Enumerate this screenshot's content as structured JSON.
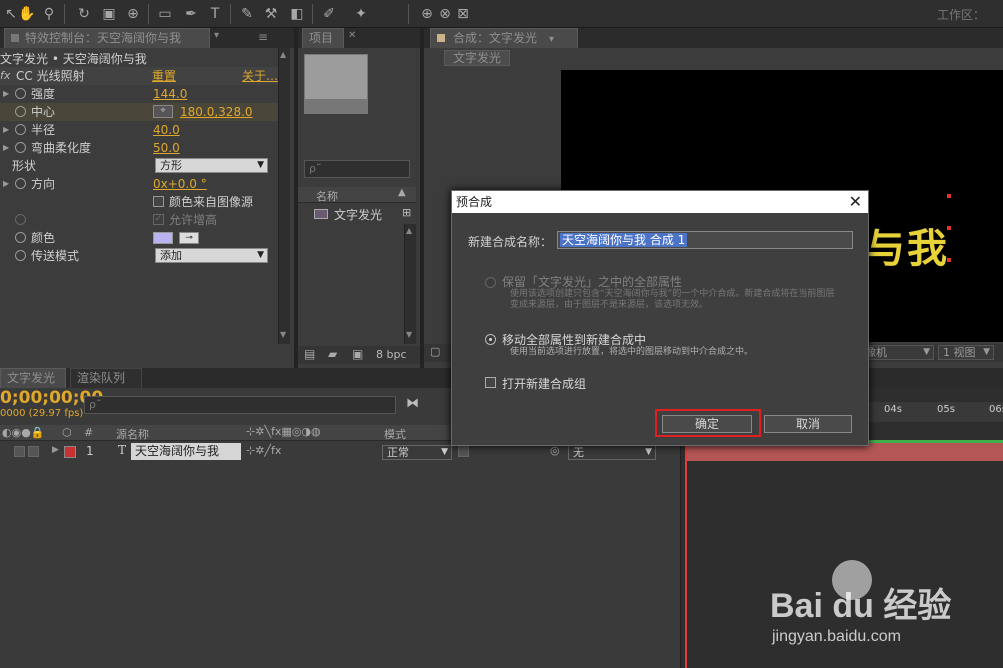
{
  "toolbar": {
    "workspace_label": "工作区："
  },
  "effect_controls": {
    "tab_label": "特效控制台：天空海阔你与我",
    "breadcrumb": "文字发光 • 天空海阔你与我",
    "effect_name": "CC 光线照射",
    "reset_label": "重置",
    "about_label": "关于…",
    "rows": [
      {
        "label": "强度",
        "value": "144.0"
      },
      {
        "label": "中心",
        "value": "180.0,328.0"
      },
      {
        "label": "半径",
        "value": "40.0"
      },
      {
        "label": "弯曲柔化度",
        "value": "50.0"
      },
      {
        "label": "形状",
        "value": "方形"
      },
      {
        "label": "方向",
        "value": "0x+0.0 °"
      },
      {
        "label": "颜色来自图像源",
        "value": ""
      },
      {
        "label": "允许增高",
        "value": ""
      },
      {
        "label": "颜色",
        "value": ""
      },
      {
        "label": "传送模式",
        "value": "添加"
      }
    ],
    "color_swatch": "#b9b4f0"
  },
  "project": {
    "tab_label": "项目",
    "search_placeholder": "ρ˜",
    "col_name": "名称",
    "item_name": "文字发光",
    "bpc_label": "8 bpc"
  },
  "composition": {
    "tab_label": "合成：文字发光",
    "subtab_label": "文字发光",
    "preview_text": "与我",
    "camera_label": "像机",
    "view_label": "1 视图"
  },
  "timeline": {
    "tab_main": "文字发光",
    "tab_render": "渲染队列",
    "timecode": "0;00;00;00",
    "fps": "0000 (29.97 fps)",
    "search_placeholder": "ρ˜",
    "col_source_name": "源名称",
    "col_mode": "模式",
    "col_hash": "#",
    "layer_num": "1",
    "layer_type": "T",
    "layer_name": "天空海阔你与我",
    "layer_mode": "正常",
    "layer_parent": "无",
    "ruler_ticks": [
      "04s",
      "05s",
      "06s"
    ],
    "layer_color": "#c83232"
  },
  "dialog": {
    "title": "预合成",
    "name_label": "新建合成名称：",
    "name_value": "天空海阔你与我 合成 1",
    "opt1_label": "保留「文字发光」之中的全部属性",
    "opt1_desc": "使用该选项创建只包含“天空海阔你与我”的一个中介合成。新建合成将在当前图层变成来源层，由于图层不是来源层，该选项无效。",
    "opt2_label": "移动全部属性到新建合成中",
    "opt2_desc": "使用当前选项进行放置，将选中的图层移动到中介合成之中。",
    "open_label": "打开新建合成组",
    "ok_label": "确定",
    "cancel_label": "取消"
  },
  "watermark": {
    "brand": "Bai du 经验",
    "url": "jingyan.baidu.com"
  }
}
